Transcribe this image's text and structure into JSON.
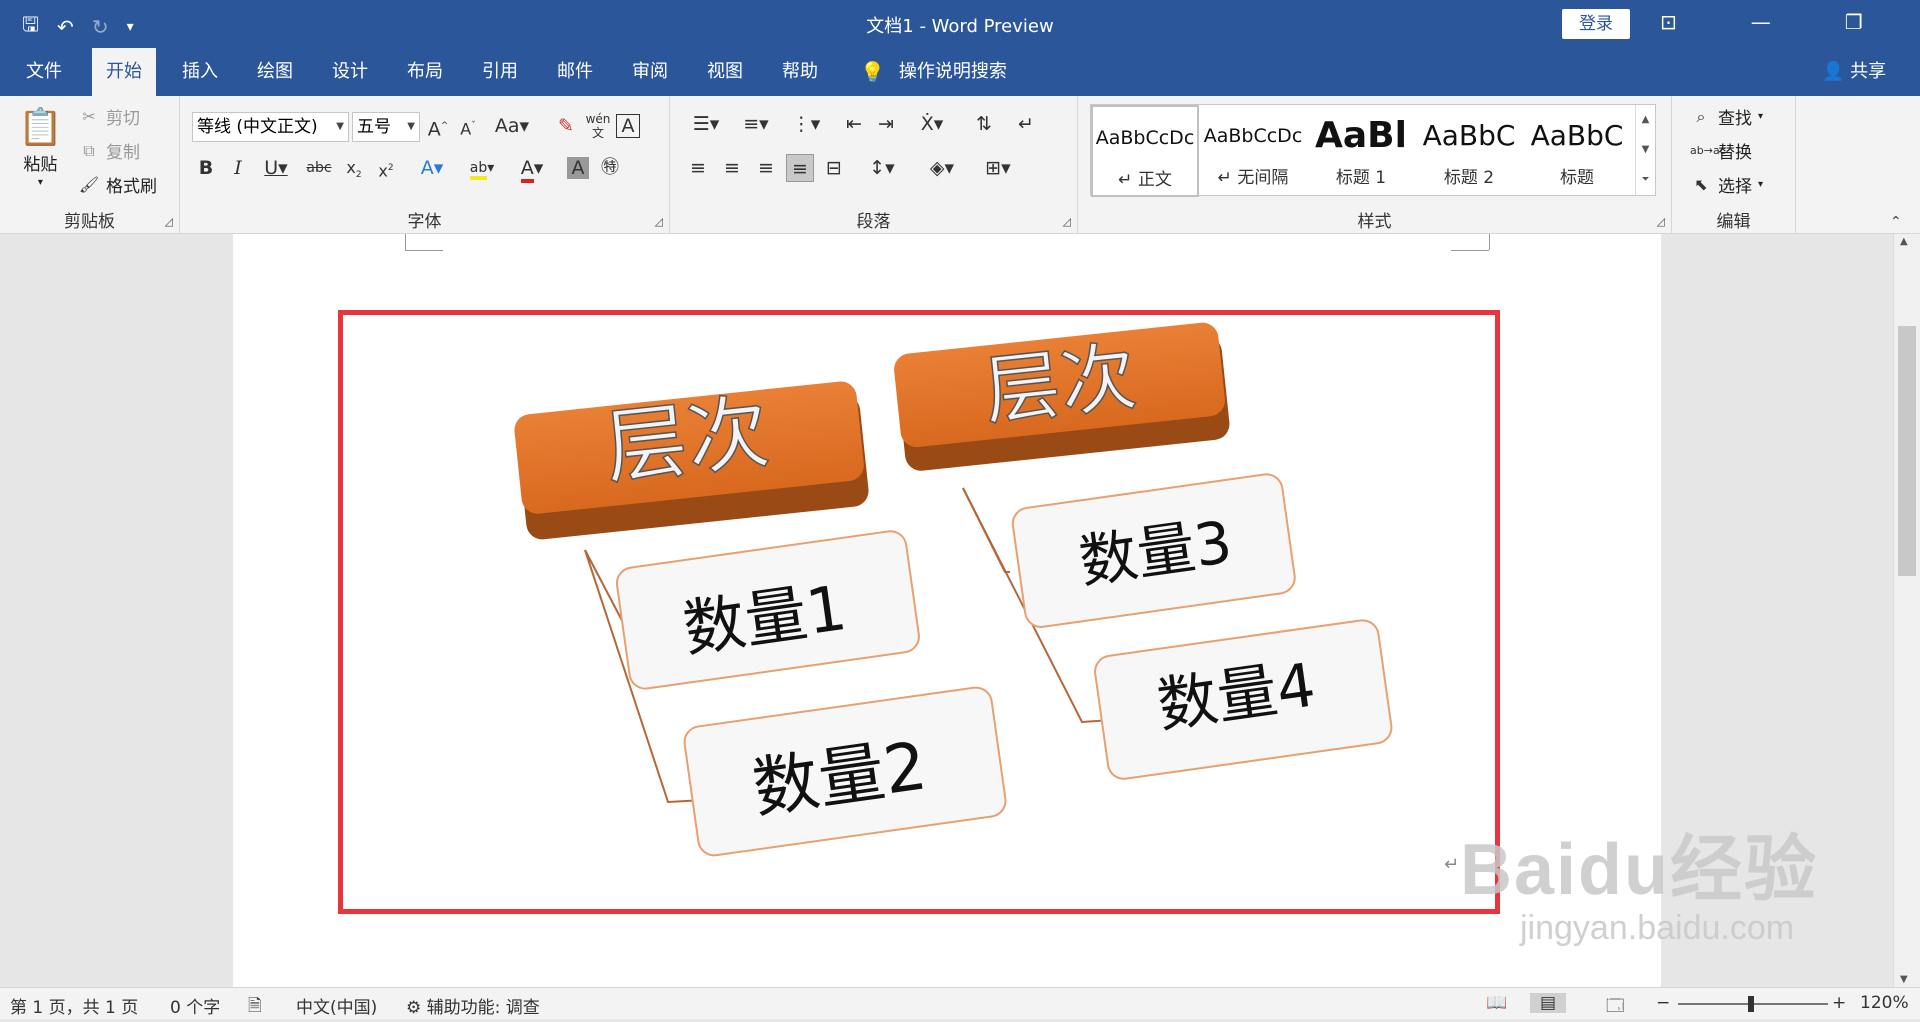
{
  "window": {
    "title": "文档1  -  Word Preview",
    "login": "登录"
  },
  "tabs": [
    "文件",
    "开始",
    "插入",
    "绘图",
    "设计",
    "布局",
    "引用",
    "邮件",
    "审阅",
    "视图",
    "帮助"
  ],
  "tell_me": "操作说明搜索",
  "share": "共享",
  "clipboard": {
    "paste": "粘贴",
    "cut": "剪切",
    "copy": "复制",
    "format_painter": "格式刷",
    "label": "剪贴板"
  },
  "font": {
    "name": "等线 (中文正文)",
    "size": "五号",
    "label": "字体"
  },
  "paragraph": {
    "label": "段落"
  },
  "styles": {
    "label": "样式",
    "items": [
      {
        "preview": "AaBbCcDc",
        "name": "↵ 正文"
      },
      {
        "preview": "AaBbCcDc",
        "name": "↵ 无间隔"
      },
      {
        "preview": "AaBl",
        "name": "标题 1"
      },
      {
        "preview": "AaBbC",
        "name": "标题 2"
      },
      {
        "preview": "AaBbC",
        "name": "标题"
      }
    ]
  },
  "editing": {
    "find": "查找",
    "replace": "替换",
    "select": "选择",
    "label": "编辑"
  },
  "diagram": {
    "headers": [
      "层次",
      "层次"
    ],
    "items": [
      "数量1",
      "数量2",
      "数量3",
      "数量4"
    ],
    "colors": {
      "header": "#e07a2e",
      "header_dark": "#9a4a14",
      "item_border": "#e8a070",
      "item_fill": "#f7f7f7",
      "frame": "#e8343d"
    }
  },
  "status": {
    "page": "第 1 页，共 1 页",
    "words": "0 个字",
    "lang": "中文(中国)",
    "accessibility": "辅助功能: 调查",
    "zoom": "120%"
  },
  "watermark": {
    "brand": "Baidu经验",
    "url": "jingyan.baidu.com"
  }
}
